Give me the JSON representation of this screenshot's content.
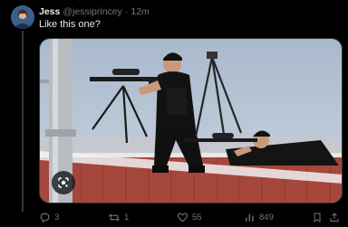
{
  "tweet": {
    "display_name": "Jess",
    "handle": "@jessiprincey",
    "separator": "·",
    "time": "12m",
    "text": "Like this one?"
  },
  "actions": {
    "replies": "3",
    "reposts": "1",
    "likes": "55",
    "views": "849"
  },
  "icons": {
    "reply": "reply-icon",
    "repost": "repost-icon",
    "like": "heart-icon",
    "views": "views-icon",
    "bookmark": "bookmark-icon",
    "share": "share-icon",
    "lens": "google-lens-icon"
  },
  "colors": {
    "background": "#000000",
    "text": "#e7e9ea",
    "muted": "#71767b"
  }
}
